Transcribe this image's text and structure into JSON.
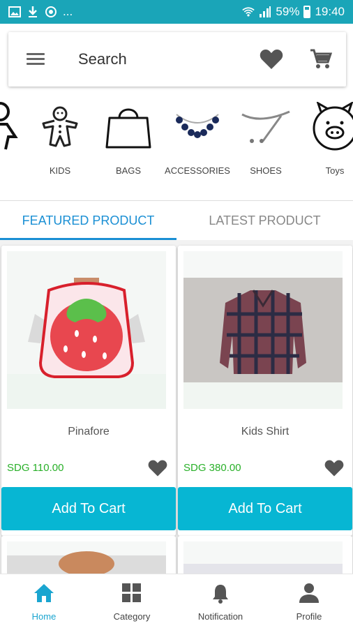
{
  "status_bar": {
    "battery": "59%",
    "time": "19:40",
    "dots": "..."
  },
  "search": {
    "placeholder": "Search"
  },
  "categories": [
    {
      "label": "",
      "icon": "person-icon"
    },
    {
      "label": "KIDS",
      "icon": "gingerbread-icon"
    },
    {
      "label": "BAGS",
      "icon": "bag-icon"
    },
    {
      "label": "ACCESSORIES",
      "icon": "necklace-icon"
    },
    {
      "label": "SHOES",
      "icon": "shoe-icon"
    },
    {
      "label": "Toys",
      "icon": "piggy-bank-icon"
    }
  ],
  "tabs": {
    "featured": "FEATURED PRODUCT",
    "latest": "LATEST PRODUCT"
  },
  "products": [
    {
      "name": "Pinafore",
      "price": "SDG 110.00",
      "button": "Add To Cart"
    },
    {
      "name": "Kids Shirt",
      "price": "SDG 380.00",
      "button": "Add To Cart"
    }
  ],
  "bottom_nav": [
    {
      "label": "Home",
      "icon": "home-icon",
      "active": true
    },
    {
      "label": "Category",
      "icon": "category-icon",
      "active": false
    },
    {
      "label": "Notification",
      "icon": "bell-icon",
      "active": false
    },
    {
      "label": "Profile",
      "icon": "profile-icon",
      "active": false
    }
  ],
  "colors": {
    "status_bar": "#1aa5b8",
    "accent": "#1a8fd4",
    "button": "#07b6d3",
    "price": "#29b029"
  }
}
